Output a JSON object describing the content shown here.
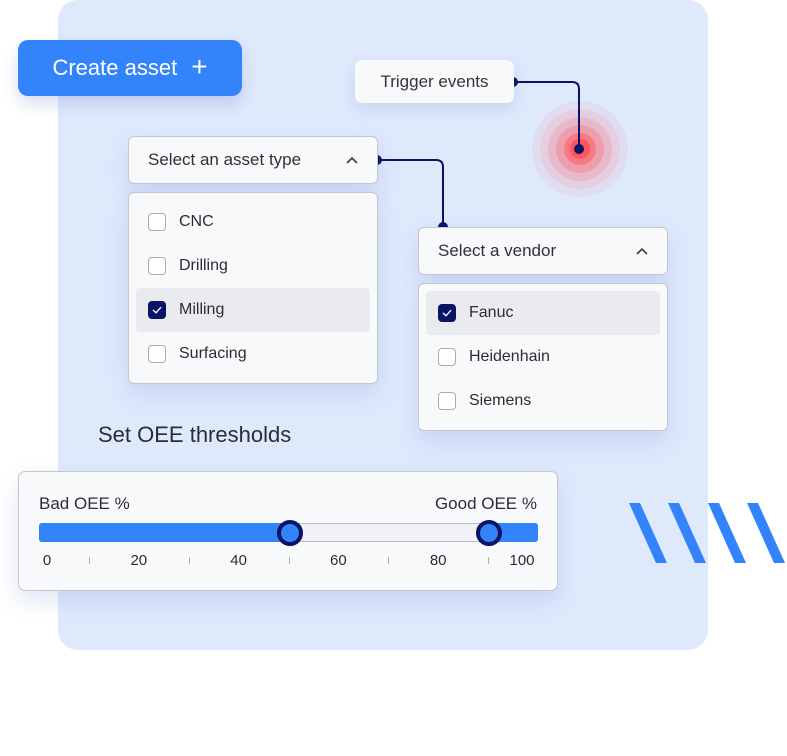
{
  "create_button": {
    "label": "Create asset",
    "icon": "plus-icon"
  },
  "trigger": {
    "label": "Trigger events"
  },
  "asset_type": {
    "placeholder": "Select an asset type",
    "icon": "chevron-up-icon",
    "options": [
      {
        "label": "CNC",
        "checked": false
      },
      {
        "label": "Drilling",
        "checked": false
      },
      {
        "label": "Milling",
        "checked": true
      },
      {
        "label": "Surfacing",
        "checked": false
      }
    ]
  },
  "vendor": {
    "placeholder": "Select a vendor",
    "icon": "chevron-up-icon",
    "options": [
      {
        "label": "Fanuc",
        "checked": true
      },
      {
        "label": "Heidenhain",
        "checked": false
      },
      {
        "label": "Siemens",
        "checked": false
      }
    ]
  },
  "oee": {
    "title": "Set OEE thresholds",
    "bad_label": "Bad OEE %",
    "good_label": "Good OEE %",
    "min": 0,
    "max": 100,
    "bad_value": 50,
    "good_value": 90,
    "tick_labels": [
      "0",
      "20",
      "40",
      "60",
      "80",
      "100"
    ]
  },
  "colors": {
    "accent": "#3383fb",
    "navy": "#0a1464",
    "panel": "#dfe9fc",
    "pulse": "#ff4d55"
  }
}
